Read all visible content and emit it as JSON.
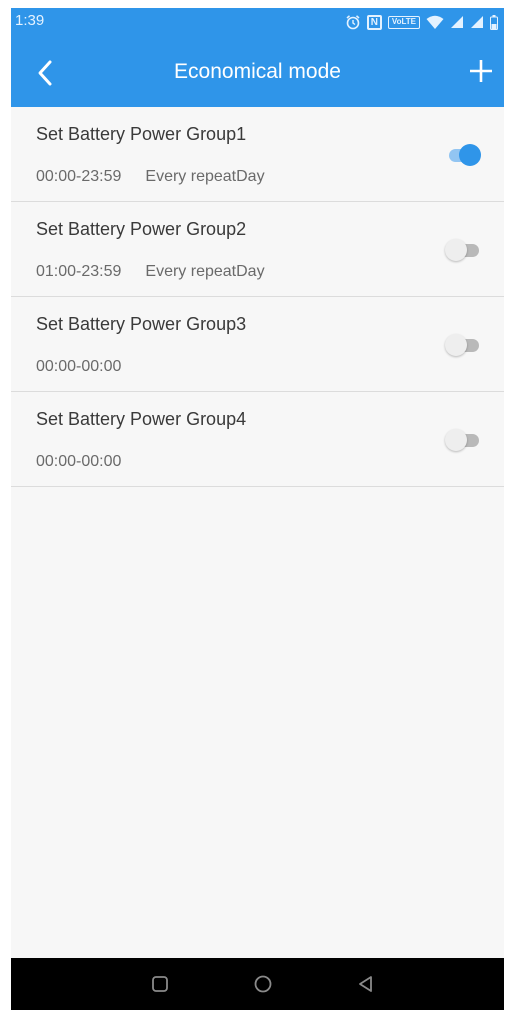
{
  "status_bar": {
    "time": "1:39",
    "volte_label": "VoLTE",
    "nfc_label": "N"
  },
  "app_bar": {
    "title": "Economical mode",
    "back_icon": "chevron-left-icon",
    "add_icon": "plus-icon"
  },
  "schedules": [
    {
      "title": "Set Battery Power Group1",
      "time_range": "00:00-23:59",
      "repeat": "Every repeatDay",
      "enabled": true
    },
    {
      "title": "Set Battery Power Group2",
      "time_range": "01:00-23:59",
      "repeat": "Every repeatDay",
      "enabled": false
    },
    {
      "title": "Set Battery Power Group3",
      "time_range": "00:00-00:00",
      "repeat": "",
      "enabled": false
    },
    {
      "title": "Set Battery Power Group4",
      "time_range": "00:00-00:00",
      "repeat": "",
      "enabled": false
    }
  ],
  "colors": {
    "accent": "#2f95e9",
    "toggle_off": "#b9b9b9"
  }
}
